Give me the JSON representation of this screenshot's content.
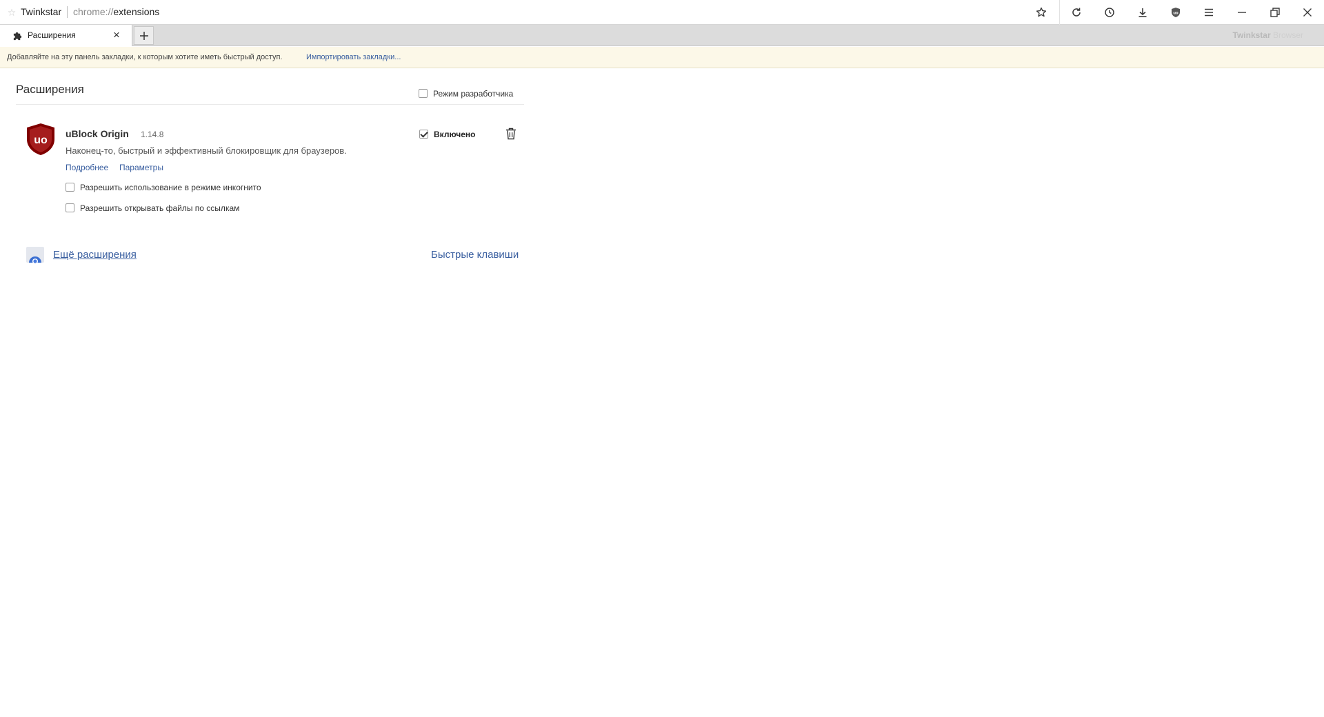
{
  "titlebar": {
    "site_icon": "star-outline-icon",
    "brand": "Twinkstar",
    "url_scheme": "chrome://",
    "url_path": "extensions",
    "buttons": [
      {
        "name": "bookmark-star-icon"
      },
      {
        "name": "refresh-icon"
      },
      {
        "name": "history-clock-icon"
      },
      {
        "name": "download-icon"
      },
      {
        "name": "ublock-shield-icon"
      },
      {
        "name": "menu-hamburger-icon"
      },
      {
        "name": "minimize-icon"
      },
      {
        "name": "restore-icon"
      },
      {
        "name": "close-icon"
      }
    ]
  },
  "tabs": [
    {
      "title": "Расширения",
      "icon": "puzzle-icon",
      "active": true
    }
  ],
  "browser_label": {
    "bold": "Twinkstar",
    "thin": "Browser"
  },
  "bookmarks_bar": {
    "message": "Добавляйте на эту панель закладки, к которым хотите иметь быстрый доступ.",
    "import_link": "Импортировать закладки..."
  },
  "page": {
    "title": "Расширения",
    "developer_mode": {
      "label": "Режим разработчика",
      "checked": false
    }
  },
  "extension": {
    "name": "uBlock Origin",
    "version": "1.14.8",
    "description": "Наконец-то, быстрый и эффективный блокировщик для браузеров.",
    "details_link": "Подробнее",
    "options_link": "Параметры",
    "enabled": {
      "label": "Включено",
      "checked": true
    },
    "options": [
      {
        "label": "Разрешить использование в режиме инкогнито",
        "checked": false
      },
      {
        "label": "Разрешить открывать файлы по ссылкам",
        "checked": false
      }
    ],
    "icon_color": "#800000"
  },
  "footer": {
    "more_extensions": "Ещё расширения",
    "keyboard_shortcuts": "Быстрые клавиши"
  },
  "colors": {
    "link": "#3a5fa0",
    "bookmarks_bg": "#fcf8e8",
    "tabstrip_bg": "#dcdcdc"
  }
}
